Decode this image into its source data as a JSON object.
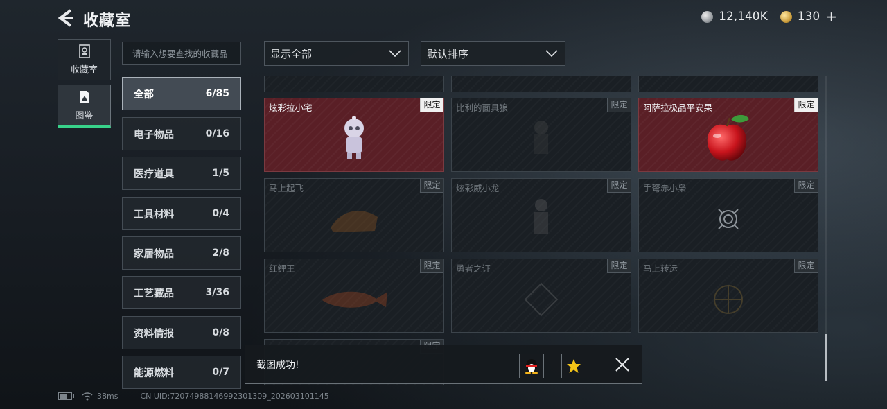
{
  "header": {
    "title": "收藏室",
    "currency": [
      {
        "icon": "silver-coin-icon",
        "value": "12,140K"
      },
      {
        "icon": "gold-coin-icon",
        "value": "130"
      }
    ],
    "plus_label": "+"
  },
  "left_tabs": [
    {
      "label": "收藏室",
      "icon": "collection-room-icon",
      "active": false
    },
    {
      "label": "图鉴",
      "icon": "handbook-icon",
      "active": true
    }
  ],
  "search": {
    "placeholder": "请输入想要查找的收藏品"
  },
  "categories": [
    {
      "label": "全部",
      "count": "6/85",
      "active": true
    },
    {
      "label": "电子物品",
      "count": "0/16"
    },
    {
      "label": "医疗道具",
      "count": "1/5"
    },
    {
      "label": "工具材料",
      "count": "0/4"
    },
    {
      "label": "家居物品",
      "count": "2/8"
    },
    {
      "label": "工艺藏品",
      "count": "3/36"
    },
    {
      "label": "资料情报",
      "count": "0/8"
    },
    {
      "label": "能源燃料",
      "count": "0/7"
    }
  ],
  "filters": {
    "display": "显示全部",
    "sort": "默认排序"
  },
  "items": [
    {
      "name": "炫彩拉小宅",
      "tag": "限定",
      "owned": true,
      "art": "doll-figure-icon"
    },
    {
      "name": "比利的面具狼",
      "tag": "限定",
      "owned": false,
      "art": "masked-wolf-icon"
    },
    {
      "name": "阿萨拉极品平安果",
      "tag": "限定",
      "owned": true,
      "art": "red-apple-icon"
    },
    {
      "name": "马上起飞",
      "tag": "限定",
      "owned": false,
      "art": "horse-icon"
    },
    {
      "name": "炫彩威小龙",
      "tag": "限定",
      "owned": false,
      "art": "dragon-figure-icon"
    },
    {
      "name": "手弩赤小枭",
      "tag": "限定",
      "owned": false,
      "art": "owl-crossbow-icon"
    },
    {
      "name": "红鲤王",
      "tag": "限定",
      "owned": false,
      "art": "red-carp-icon"
    },
    {
      "name": "勇者之证",
      "tag": "限定",
      "owned": false,
      "art": "badge-icon"
    },
    {
      "name": "马上转运",
      "tag": "限定",
      "owned": false,
      "art": "wheel-icon"
    },
    {
      "name": "",
      "tag": "限定",
      "owned": false,
      "art": ""
    }
  ],
  "toast": {
    "message": "截图成功!"
  },
  "status_bar": {
    "ping": "38ms",
    "uid": "CN UID:7207498814699230​1309_202603101145"
  },
  "colors": {
    "accent_green": "#38d28a",
    "owned_red": "#5a1f26"
  }
}
